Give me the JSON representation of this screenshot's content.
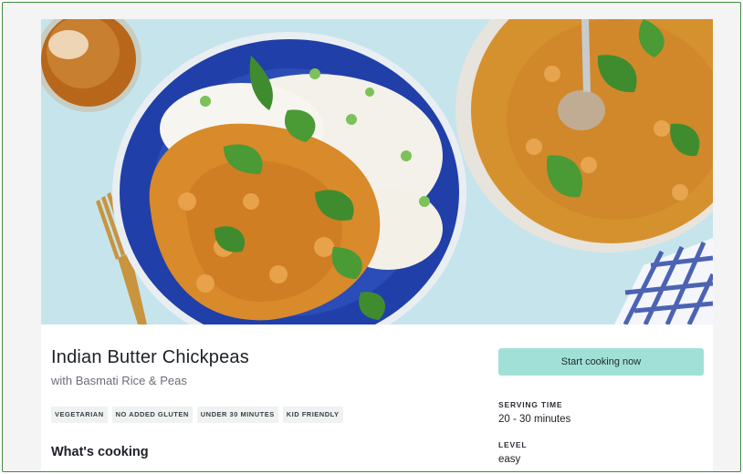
{
  "recipe": {
    "title": "Indian Butter Chickpeas",
    "subtitle": "with Basmati Rice & Peas",
    "tags": [
      "VEGETARIAN",
      "NO ADDED GLUTEN",
      "UNDER 30 MINUTES",
      "KID FRIENDLY"
    ],
    "section_heading": "What's cooking"
  },
  "sidebar": {
    "cta_label": "Start cooking now",
    "serving_time_label": "SERVING TIME",
    "serving_time_value": "20 - 30 minutes",
    "level_label": "LEVEL",
    "level_value": "easy"
  },
  "colors": {
    "cta": "#a1e0d6",
    "table": "#bfe0e8",
    "bowl": "#1f3fa6",
    "curry": "#d98a2a"
  }
}
